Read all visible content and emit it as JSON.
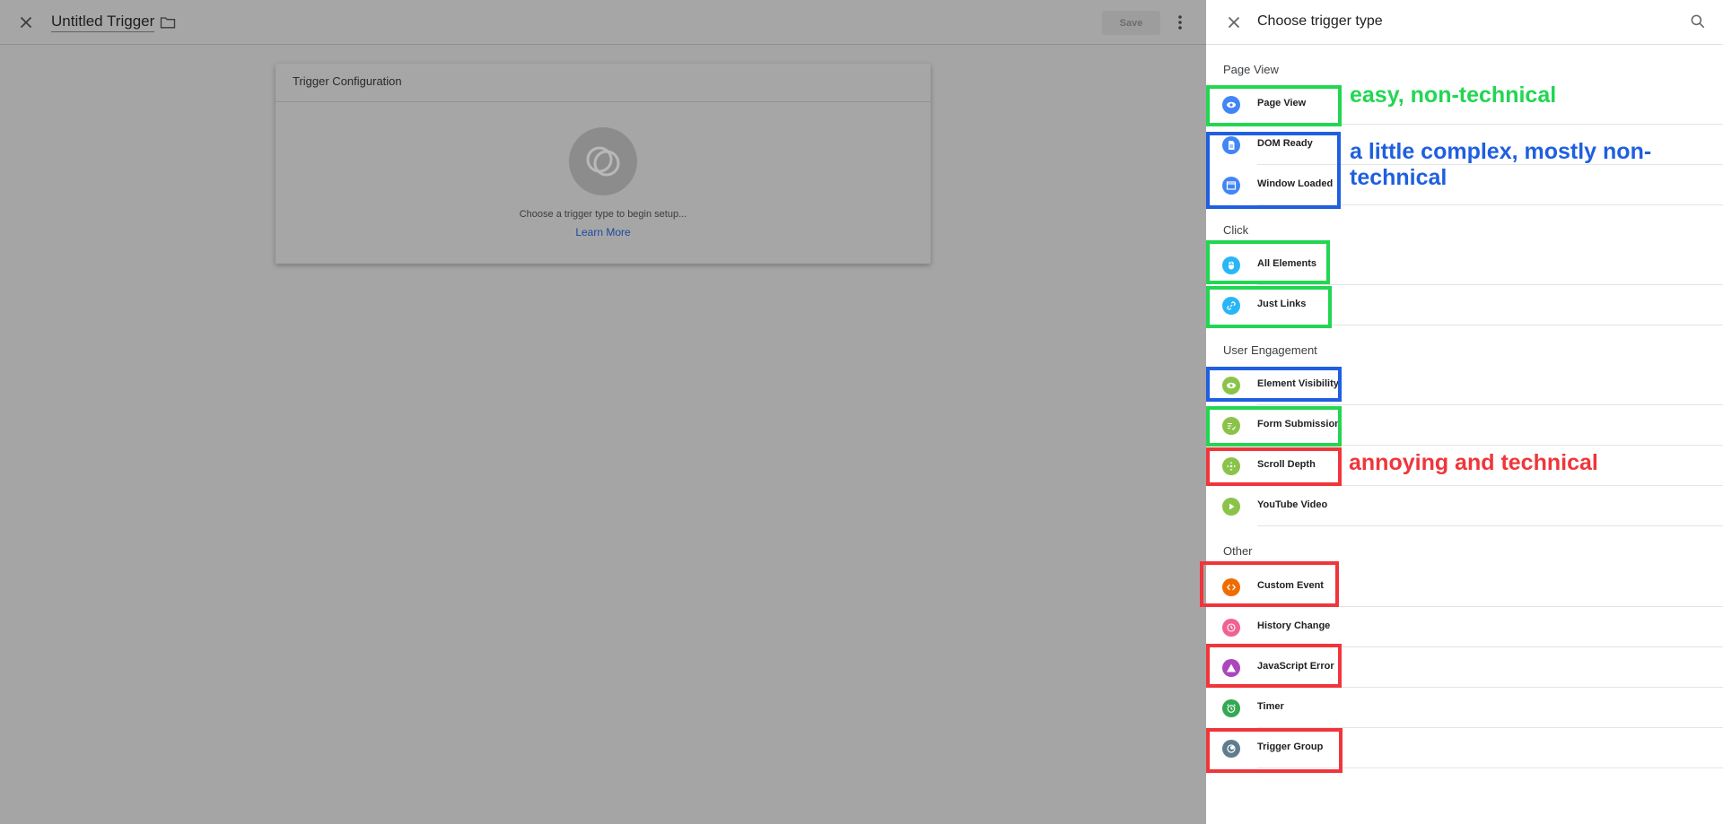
{
  "editor": {
    "title": "Untitled Trigger",
    "save_label": "Save",
    "card_title": "Trigger Configuration",
    "hint": "Choose a trigger type to begin setup...",
    "learn_more": "Learn More"
  },
  "panel": {
    "title": "Choose trigger type",
    "sections": [
      {
        "title": "Page View"
      },
      {
        "title": "Click"
      },
      {
        "title": "User Engagement"
      },
      {
        "title": "Other"
      }
    ],
    "items": [
      {
        "label": "Page View",
        "icon": "eye-icon",
        "color": "#4285f4"
      },
      {
        "label": "DOM Ready",
        "icon": "document-icon",
        "color": "#4285f4"
      },
      {
        "label": "Window Loaded",
        "icon": "window-icon",
        "color": "#4285f4"
      },
      {
        "label": "All Elements",
        "icon": "mouse-icon",
        "color": "#29b6f6"
      },
      {
        "label": "Just Links",
        "icon": "link-icon",
        "color": "#29b6f6"
      },
      {
        "label": "Element Visibility",
        "icon": "eye-icon",
        "color": "#8bc34a"
      },
      {
        "label": "Form Submission",
        "icon": "form-icon",
        "color": "#8bc34a"
      },
      {
        "label": "Scroll Depth",
        "icon": "move-icon",
        "color": "#8bc34a"
      },
      {
        "label": "YouTube Video",
        "icon": "play-icon",
        "color": "#8bc34a"
      },
      {
        "label": "Custom Event",
        "icon": "code-icon",
        "color": "#ef6c00"
      },
      {
        "label": "History Change",
        "icon": "history-icon",
        "color": "#f06292"
      },
      {
        "label": "JavaScript Error",
        "icon": "warning-icon",
        "color": "#ab47bc"
      },
      {
        "label": "Timer",
        "icon": "alarm-icon",
        "color": "#34a853"
      },
      {
        "label": "Trigger Group",
        "icon": "trigger-group-icon",
        "color": "#607d8b"
      }
    ]
  },
  "annotations": {
    "green_text": "easy, non-technical",
    "blue_text_line1": "a little complex, mostly non-",
    "blue_text_line2": "technical",
    "red_text": "annoying and technical",
    "colors": {
      "green": "#22d652",
      "blue": "#1f5fe0",
      "red": "#f0353b"
    }
  }
}
